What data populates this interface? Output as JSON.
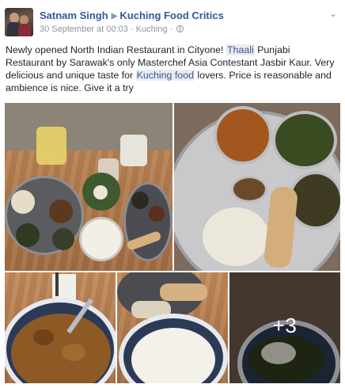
{
  "post": {
    "author_name": "Satnam Singh",
    "group_name": "Kuching Food Critics",
    "timestamp": "30 September at 00:03",
    "location": "Kuching",
    "separator": "·",
    "body": {
      "part1": "Newly opened North Indian Restaurant in Cityone! ",
      "tag1": "Thaali",
      "part2": " Punjabi Restaurant by Sarawak's only Masterchef Asia Contestant Jasbir Kaur. Very delicious and unique taste for ",
      "tag2": "Kuching food",
      "part3": " lovers. Price is reasonable and ambience is nice. Give it a try"
    },
    "photos": {
      "more_count": "+3"
    }
  },
  "colors": {
    "link": "#365899",
    "meta": "#90949c",
    "text": "#1d2129"
  },
  "icons": [
    "triangle-right-icon",
    "globe-icon",
    "chevron-down-icon"
  ]
}
